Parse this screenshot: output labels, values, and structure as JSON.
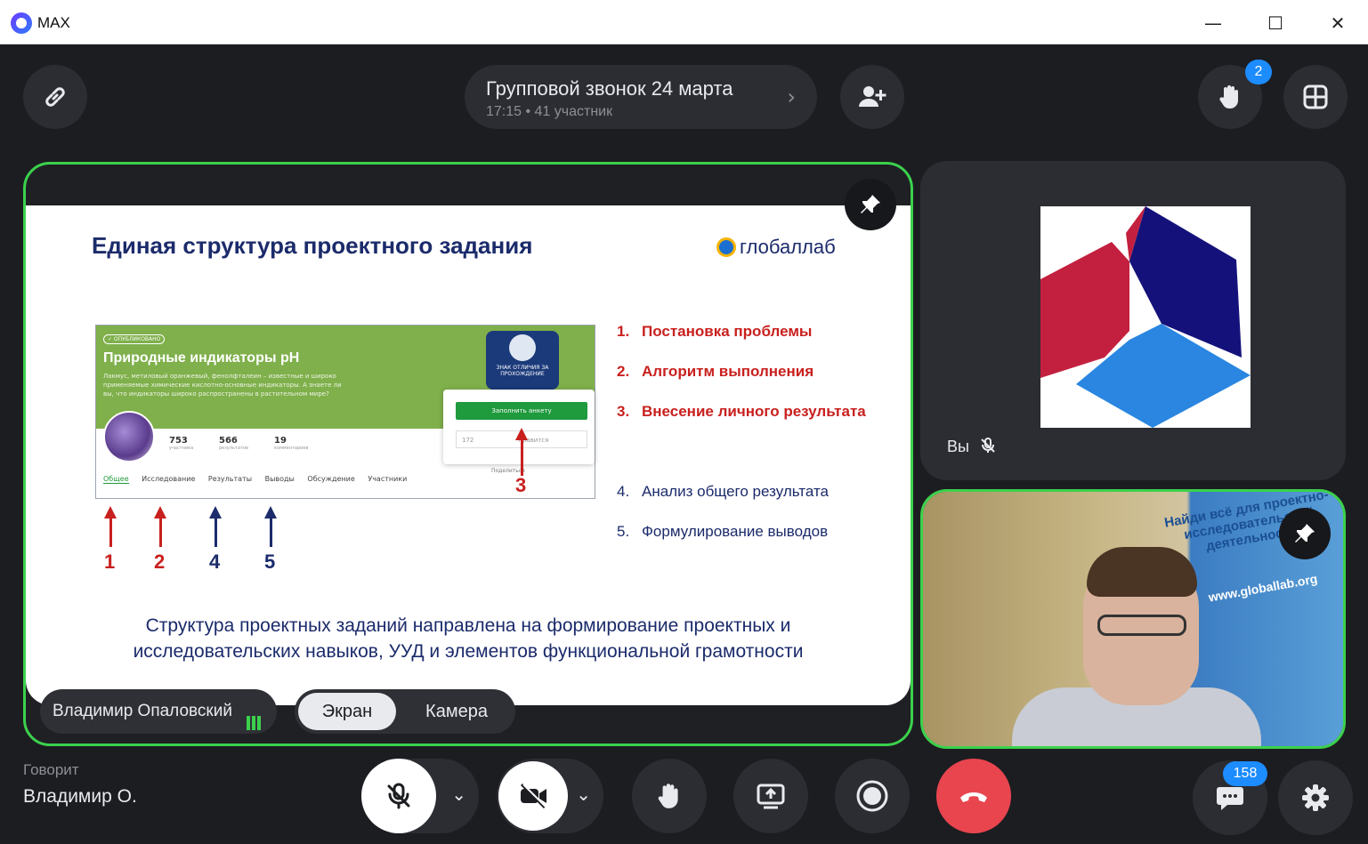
{
  "window": {
    "app_title": "MAX",
    "minimize_glyph": "—",
    "maximize_glyph": "☐",
    "close_glyph": "✕"
  },
  "header": {
    "call_title": "Групповой звонок 24 марта",
    "call_meta": "17:15 • 41 участник",
    "chevron": "›",
    "raised_hands_count": "2"
  },
  "slide": {
    "title": "Единая структура проектного задания",
    "brand": "глобаллаб",
    "screenshot": {
      "published": "✓ ОПУБЛИКОВАНО",
      "title": "Природные индикаторы pH",
      "description": "Лакмус, метиловый оранжевый, фенолфталеин – известные и широко применяемые химические кислотно-основные индикаторы. А знаете ли вы, что индикаторы широко распространены в растительном мире?",
      "badge": "ЗНАК ОТЛИЧИЯ ЗА ПРОХОЖДЕНИЕ",
      "button": "Заполнить анкету",
      "input_value": "172",
      "likes": "нравится",
      "share": "Поделиться",
      "stats": [
        {
          "value": "753",
          "label": "участника"
        },
        {
          "value": "566",
          "label": "результатов"
        },
        {
          "value": "19",
          "label": "комментариев"
        }
      ],
      "tabs": [
        "Общее",
        "Исследование",
        "Результаты",
        "Выводы",
        "Обсуждение",
        "Участники"
      ]
    },
    "arrows": [
      "1",
      "2",
      "4",
      "5",
      "3"
    ],
    "list": [
      {
        "n": "1.",
        "text": "Постановка проблемы"
      },
      {
        "n": "2.",
        "text": "Алгоритм выполнения"
      },
      {
        "n": "3.",
        "text": "Внесение личного результата"
      },
      {
        "n": "4.",
        "text": "Анализ общего результата"
      },
      {
        "n": "5.",
        "text": "Формулирование выводов"
      }
    ],
    "bottom_line1": "Структура проектных заданий направлена на формирование проектных и",
    "bottom_line2": "исследовательских навыков, УУД и элементов функциональной грамотности"
  },
  "main_tile": {
    "presenter_name": "Владимир Опаловский",
    "mode_screen": "Экран",
    "mode_camera": "Камера"
  },
  "side_tile": {
    "you_label": "Вы"
  },
  "camera_tile": {
    "banner": "Найди всё для проектно-исследовательской деятельности",
    "url": "www.globallab.org"
  },
  "footer": {
    "speaking_label": "Говорит",
    "speaking_name": "Владимир О.",
    "chat_count": "158",
    "caret": "⌄"
  },
  "colors": {
    "accent_green": "#3bd14c",
    "badge_blue": "#1c8cff",
    "end_call_red": "#e8454f",
    "slide_red": "#c8201e",
    "slide_blue": "#1b2b6b"
  }
}
